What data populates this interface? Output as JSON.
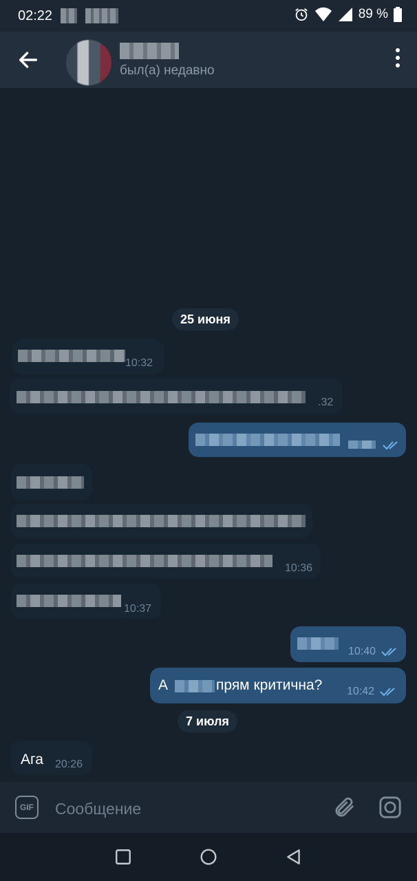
{
  "status_bar": {
    "time": "02:22",
    "battery": "89 %",
    "icons": [
      "alarm-icon",
      "wifi-icon",
      "signal-icon",
      "battery-icon"
    ]
  },
  "header": {
    "last_seen": "был(а) недавно"
  },
  "dates": [
    "25 июня",
    "7 июля"
  ],
  "messages": [
    {
      "dir": "in",
      "time": "10:32"
    },
    {
      "dir": "in",
      "time": ".32"
    },
    {
      "dir": "out",
      "time": ""
    },
    {
      "dir": "in",
      "time": ""
    },
    {
      "dir": "in",
      "time": ""
    },
    {
      "dir": "in",
      "time": "10:36"
    },
    {
      "dir": "in",
      "time": "10:37"
    },
    {
      "dir": "out",
      "time": "10:40"
    },
    {
      "dir": "out",
      "text_pre": "А",
      "text_post": "прям критична?",
      "time": "10:42"
    },
    {
      "dir": "in",
      "text": "Ага",
      "time": "20:26"
    }
  ],
  "composer": {
    "placeholder": "Сообщение",
    "gif_label": "GIF"
  },
  "colors": {
    "background": "#17212b",
    "header": "#242f3d",
    "incoming": "#182533",
    "outgoing": "#2b5278",
    "check": "#6fb1ec"
  }
}
